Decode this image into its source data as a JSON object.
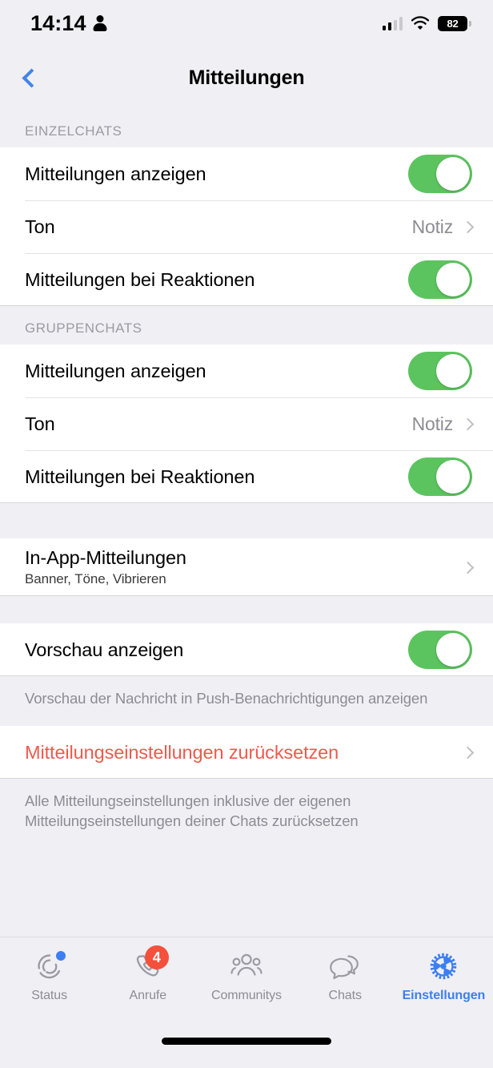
{
  "status_bar": {
    "time": "14:14",
    "person_icon": "person-icon",
    "signal_icon": "cellular-signal-icon",
    "signal_bars_filled": 2,
    "signal_bars_total": 4,
    "wifi_icon": "wifi-icon",
    "battery_level": "82",
    "battery_icon": "battery-icon"
  },
  "nav": {
    "back_icon": "chevron-left-icon",
    "title": "Mitteilungen"
  },
  "sections": [
    {
      "header": "EINZELCHATS",
      "rows": [
        {
          "label": "Mitteilungen anzeigen",
          "control": "toggle",
          "on": true
        },
        {
          "label": "Ton",
          "control": "value",
          "value": "Notiz"
        },
        {
          "label": "Mitteilungen bei Reaktionen",
          "control": "toggle",
          "on": true
        }
      ]
    },
    {
      "header": "GRUPPENCHATS",
      "rows": [
        {
          "label": "Mitteilungen anzeigen",
          "control": "toggle",
          "on": true
        },
        {
          "label": "Ton",
          "control": "value",
          "value": "Notiz"
        },
        {
          "label": "Mitteilungen bei Reaktionen",
          "control": "toggle",
          "on": true
        }
      ]
    }
  ],
  "in_app": {
    "label": "In-App-Mitteilungen",
    "sublabel": "Banner, Töne, Vibrieren"
  },
  "preview": {
    "label": "Vorschau anzeigen",
    "on": true,
    "footer": "Vorschau der Nachricht in Push-Benachrichtigungen anzeigen"
  },
  "reset": {
    "label": "Mitteilungseinstellungen zurücksetzen",
    "footer": "Alle Mitteilungseinstellungen inklusive der eigenen Mitteilungseinstellungen deiner Chats zurücksetzen"
  },
  "tabs": [
    {
      "label": "Status",
      "icon": "status-rings-icon",
      "active": false,
      "dot": true
    },
    {
      "label": "Anrufe",
      "icon": "phone-icon",
      "active": false,
      "badge": "4"
    },
    {
      "label": "Communitys",
      "icon": "people-group-icon",
      "active": false
    },
    {
      "label": "Chats",
      "icon": "chat-bubbles-icon",
      "active": false
    },
    {
      "label": "Einstellungen",
      "icon": "gear-icon",
      "active": true
    }
  ],
  "colors": {
    "background": "#f0eff4",
    "card": "#ffffff",
    "toggle_on": "#5cc45f",
    "accent_blue": "#3c7ff0",
    "destructive_red": "#f0594c",
    "secondary_text": "#8c8c92"
  },
  "home_indicator": "home-indicator"
}
